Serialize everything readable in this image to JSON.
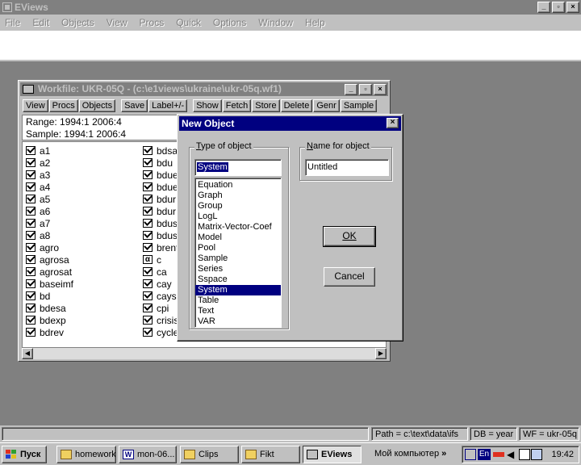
{
  "app": {
    "title": "EViews",
    "window_buttons": [
      "_",
      "▫",
      "×"
    ]
  },
  "menu": [
    "File",
    "Edit",
    "Objects",
    "View",
    "Procs",
    "Quick",
    "Options",
    "Window",
    "Help"
  ],
  "workfile": {
    "title": "Workfile: UKR-05Q - (c:\\e1views\\ukraine\\ukr-05q.wf1)",
    "toolbar": [
      "View",
      "Procs",
      "Objects",
      "Save",
      "Label+/-",
      "Show",
      "Fetch",
      "Store",
      "Delete",
      "Genr",
      "Sample"
    ],
    "range": "Range:   1994:1 2006:4",
    "sample": "Sample: 1994:1 2006:4",
    "objects_col1": [
      "a1",
      "a2",
      "a3",
      "a4",
      "a5",
      "a6",
      "a7",
      "a8",
      "agro",
      "agrosa",
      "agrosat",
      "baseimf",
      "bd",
      "bdesa",
      "bdexp",
      "bdrev"
    ],
    "objects_col2": [
      "bdsa",
      "bdu",
      "bdue",
      "bdue",
      "bdur",
      "bdur",
      "bdus",
      "bdus",
      "brent",
      "c",
      "ca",
      "cay",
      "cays",
      "cpi",
      "crisis",
      "cycle"
    ],
    "coef_object": "c"
  },
  "dialog": {
    "title": "New Object",
    "type_label": "Type of object",
    "type_value": "System",
    "types": [
      "Equation",
      "Graph",
      "Group",
      "LogL",
      "Matrix-Vector-Coef",
      "Model",
      "Pool",
      "Sample",
      "Series",
      "Sspace",
      "System",
      "Table",
      "Text",
      "VAR"
    ],
    "selected_type": "System",
    "name_label": "Name for object",
    "name_value": "Untitled",
    "ok_label": "OK",
    "cancel_label": "Cancel"
  },
  "status": {
    "path": "Path = c:\\text\\data\\ifs",
    "db": "DB = year",
    "wf": "WF = ukr-05q"
  },
  "taskbar": {
    "start": "Пуск",
    "tasks": [
      "homework",
      "mon-06...",
      "Clips",
      "Fikt",
      "EViews"
    ],
    "active_task": "EViews",
    "my_computer": "Мой компьютер",
    "lang": "En",
    "clock": "19:42"
  },
  "colors": {
    "desktop": "#808080",
    "dialog_title": "#000080",
    "face": "#c0c0c0"
  }
}
